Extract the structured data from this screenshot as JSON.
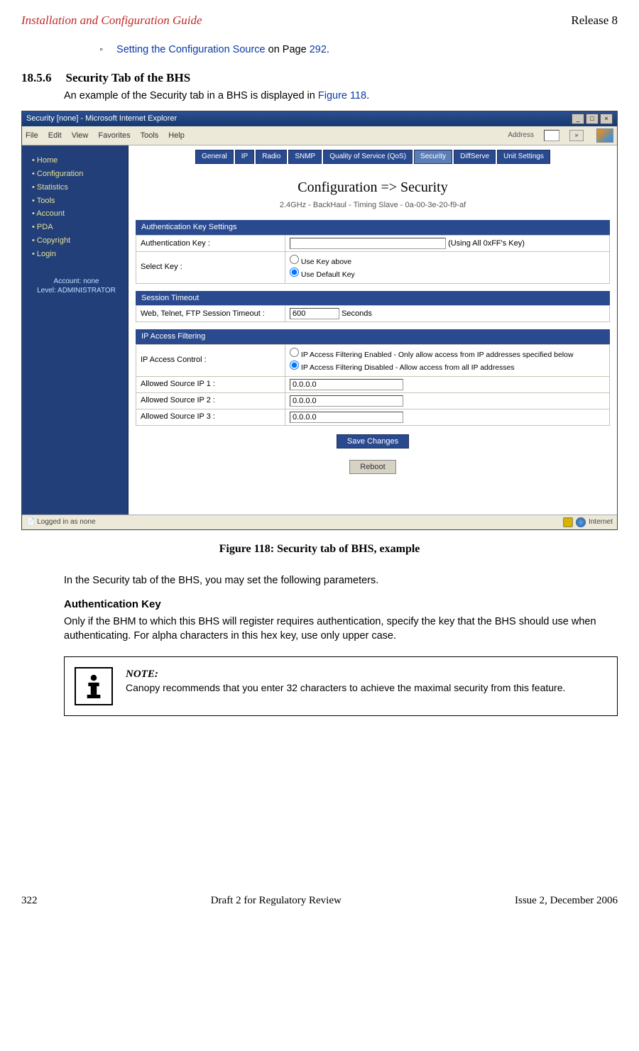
{
  "header": {
    "left": "Installation and Configuration Guide",
    "right": "Release 8"
  },
  "bullet": {
    "link_text": "Setting the Configuration Source",
    "mid": " on Page ",
    "page": "292",
    "dot": "."
  },
  "section": {
    "number": "18.5.6",
    "title": "Security Tab of the BHS"
  },
  "intro": {
    "pre": "An example of the Security tab in a BHS is displayed in ",
    "link": "Figure 118",
    "post": "."
  },
  "ie": {
    "title": "Security [none] - Microsoft Internet Explorer",
    "menus": [
      "File",
      "Edit",
      "View",
      "Favorites",
      "Tools",
      "Help"
    ],
    "address_label": "Address",
    "go": "»",
    "sidebar_items": [
      "Home",
      "Configuration",
      "Statistics",
      "Tools",
      "Account",
      "PDA",
      "Copyright",
      "Login"
    ],
    "account_line1": "Account: none",
    "account_line2": "Level: ADMINISTRATOR",
    "tabs": [
      "General",
      "IP",
      "Radio",
      "SNMP",
      "Quality of Service (QoS)",
      "Security",
      "DiffServe",
      "Unit Settings"
    ],
    "content_title": "Configuration => Security",
    "content_sub": "2.4GHz - BackHaul - Timing Slave - 0a-00-3e-20-f9-af",
    "sections": {
      "auth": {
        "bar": "Authentication Key Settings",
        "row1_label": "Authentication Key :",
        "row1_note": "(Using All 0xFF's Key)",
        "row2_label": "Select Key :",
        "radio1": "Use Key above",
        "radio2": "Use Default Key"
      },
      "session": {
        "bar": "Session Timeout",
        "row1_label": "Web, Telnet, FTP Session Timeout :",
        "row1_value": "600",
        "row1_unit": "Seconds"
      },
      "ipfilter": {
        "bar": "IP Access Filtering",
        "row1_label": "IP Access Control :",
        "radio1": "IP Access Filtering Enabled - Only allow access from IP addresses specified below",
        "radio2": "IP Access Filtering Disabled - Allow access from all IP addresses",
        "ip1_label": "Allowed Source IP 1 :",
        "ip2_label": "Allowed Source IP 2 :",
        "ip3_label": "Allowed Source IP 3 :",
        "ip_value": "0.0.0.0"
      }
    },
    "save_btn": "Save Changes",
    "reboot_btn": "Reboot",
    "status_left": "Logged in as none",
    "status_right": "Internet"
  },
  "caption": "Figure 118: Security tab of BHS, example",
  "para_after": "In the Security tab of the BHS, you may set the following parameters.",
  "auth_head": "Authentication Key",
  "auth_para": "Only if the BHM to which this BHS will register requires authentication, specify the key that the BHS should use when authenticating. For alpha characters in this hex key, use only upper case.",
  "note": {
    "label": "NOTE:",
    "text": "Canopy recommends that you enter 32 characters to achieve the maximal security from this feature."
  },
  "footer": {
    "left": "322",
    "center": "Draft 2 for Regulatory Review",
    "right": "Issue 2, December 2006"
  }
}
